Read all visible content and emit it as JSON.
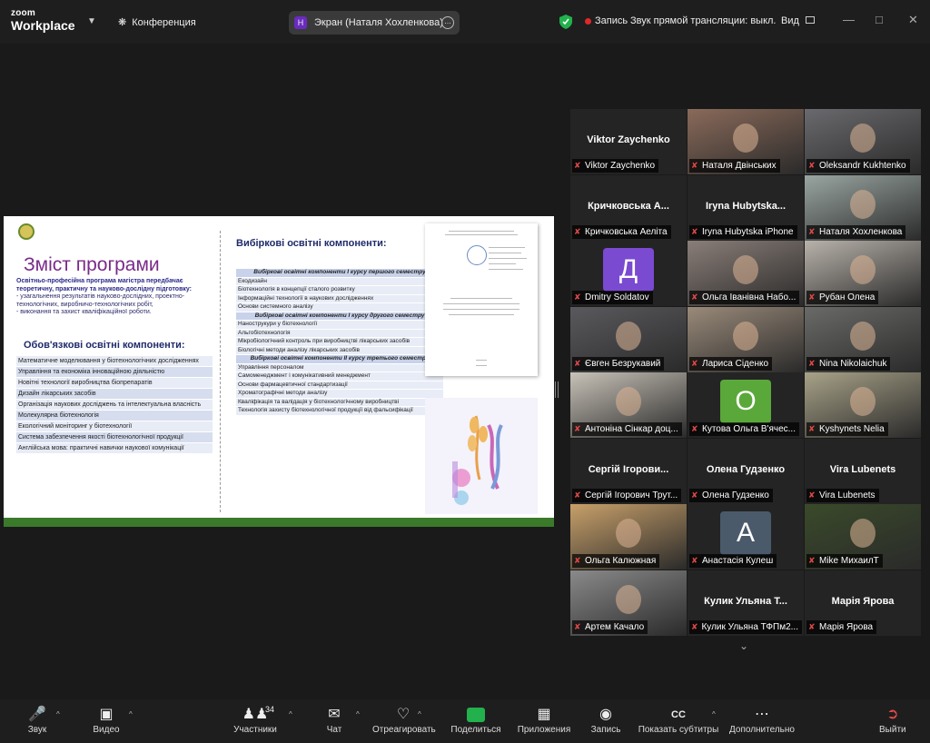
{
  "topbar": {
    "logo_line1": "zoom",
    "logo_line2": "Workplace",
    "conference_label": "Конференция",
    "screen_share_initial": "Н",
    "screen_share_label": "Экран (Наталя Хохленкова)",
    "record_label": "Запись",
    "stream_label": "Звук прямой трансляции: выкл.",
    "view_label": "Вид"
  },
  "slide": {
    "title": "Зміст програми",
    "intro_bold": "Освітньо-професійна програма магістра передбачає теоретичну, практичну та науково-дослідну підготовку:",
    "intro_items": [
      "- узагальнення результатів науково-дослідних, проектно-технологічних, виробничо-технологічних робіт,",
      "- виконання та захист кваліфікаційної роботи."
    ],
    "oblig_title": "Обов'язкові освітні компоненти:",
    "oblig_items": [
      "Математичне моделювання у біотехнологічних дослідженнях",
      "Управління та економіка інноваційною діяльністю",
      "Новітні технології виробництва біопрепаратів",
      "Дизайн лікарських засобів",
      "Організація наукових досліджень та інтелектуальна власність",
      "Молекулярна біотехнологія",
      "Екологічний моніторинг у біотехнології",
      "Система забезпечення якості біотехнологічної продукції",
      "Англійська мова: практичні навички наукової комунікації"
    ],
    "vib_title": "Вибіркові освітні компоненти:",
    "vib_rows": [
      {
        "h": true,
        "t": "Вибіркові освітні компоненти І курсу першого семестру"
      },
      {
        "h": false,
        "t": "Екодизайн"
      },
      {
        "h": false,
        "t": "Біотехнологія в концепції сталого розвитку"
      },
      {
        "h": false,
        "t": "Інформаційні технології в наукових дослідженнях"
      },
      {
        "h": false,
        "t": "Основи системного аналізу"
      },
      {
        "h": true,
        "t": "Вибіркові освітні компоненти І курсу другого семестру"
      },
      {
        "h": false,
        "t": "Нанострукури у біотехнології"
      },
      {
        "h": false,
        "t": "Альгобіотехнологія"
      },
      {
        "h": false,
        "t": "Мікробіологічний контроль при виробництві лікарських засобів"
      },
      {
        "h": false,
        "t": "Біологічні методи аналізу лікарських засобів"
      },
      {
        "h": true,
        "t": "Вибіркові освітні компоненти ІІ курсу третього семестру"
      },
      {
        "h": false,
        "t": "Управління персоналом"
      },
      {
        "h": false,
        "t": "Самоменеджмент і комунікативний менеджмент"
      },
      {
        "h": false,
        "t": "Основи фармацевтичної стандартизації"
      },
      {
        "h": false,
        "t": "Хроматографічні методи аналізу"
      },
      {
        "h": false,
        "t": "Кваліфікація та валідація у біотехнологічному виробництві"
      },
      {
        "h": false,
        "t": "Технологія захисту біотехнологічної продукції від фальсифікації"
      }
    ]
  },
  "participants": [
    {
      "label": "Viktor Zaychenko",
      "big": "Viktor Zaychenko",
      "type": "name",
      "color": "#242424"
    },
    {
      "label": "Наталя Двінських",
      "type": "video",
      "color": "#8a6a5a"
    },
    {
      "label": "Oleksandr Kukhtenko",
      "type": "video",
      "color": "#6a6a6e"
    },
    {
      "label": "Кричковська Аеліта",
      "big": "Кричковська А...",
      "type": "name",
      "color": "#242424"
    },
    {
      "label": "Iryna Hubytska iPhone",
      "big": "Iryna Hubytska...",
      "type": "name",
      "color": "#242424"
    },
    {
      "label": "Наталя Хохленкова",
      "type": "video",
      "color": "#9aa6a2",
      "active": true
    },
    {
      "label": "Dmitry Soldatov",
      "type": "avatar",
      "initial": "Д",
      "color": "#7a4ad0"
    },
    {
      "label": "Ольга Іванівна Набо...",
      "type": "video",
      "color": "#8a7e78"
    },
    {
      "label": "Рубан Олена",
      "type": "video",
      "color": "#b8b2aa"
    },
    {
      "label": "Євген Безрукавий",
      "type": "video",
      "color": "#5a5a5e"
    },
    {
      "label": "Лариса Сіденко",
      "type": "video",
      "color": "#9a8a7a"
    },
    {
      "label": "Nina Nikolaichuk",
      "type": "video",
      "color": "#6a6a68"
    },
    {
      "label": "Антоніна Сінкар доц...",
      "type": "video",
      "color": "#c8c2b8"
    },
    {
      "label": "Кутова Ольга В'ячес...",
      "type": "avatar",
      "initial": "О",
      "color": "#5aa83a"
    },
    {
      "label": "Kyshynets Nelia",
      "type": "video",
      "color": "#a8a288"
    },
    {
      "label": "Сергій Ігорович Трут...",
      "big": "Сергій Ігорови...",
      "type": "name",
      "color": "#242424"
    },
    {
      "label": "Олена Гудзенко",
      "big": "Олена Гудзенко",
      "type": "name",
      "color": "#242424"
    },
    {
      "label": "Vira Lubenets",
      "big": "Vira Lubenets",
      "type": "name",
      "color": "#242424"
    },
    {
      "label": "Ольга Калюжная",
      "type": "video",
      "color": "#c8a06a"
    },
    {
      "label": "Анастасія Кулеш",
      "type": "avatar",
      "initial": "А",
      "color": "#4a5a6a"
    },
    {
      "label": "Mike МихаилТ",
      "type": "video",
      "color": "#3a4a2a"
    },
    {
      "label": "Артем Качало",
      "type": "video",
      "color": "#8a8a8a"
    },
    {
      "label": "Кулик Ульяна ТФПм2...",
      "big": "Кулик Ульяна Т...",
      "type": "name",
      "color": "#242424"
    },
    {
      "label": "Марія Ярова",
      "big": "Марія Ярова",
      "type": "name",
      "color": "#242424"
    }
  ],
  "toolbar": {
    "audio": "Звук",
    "video": "Видео",
    "participants": "Участники",
    "participants_count": "34",
    "chat": "Чат",
    "react": "Отреагировать",
    "share": "Поделиться",
    "apps": "Приложения",
    "record": "Запись",
    "captions": "Показать субтитры",
    "more": "Дополнительно",
    "leave": "Выйти"
  }
}
